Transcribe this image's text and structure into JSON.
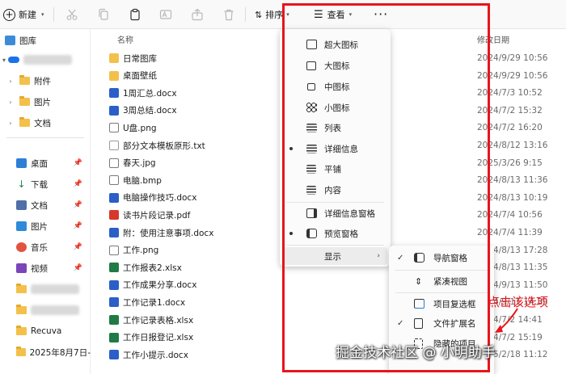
{
  "toolbar": {
    "new_label": "新建",
    "sort_label": "排序",
    "view_label": "查看",
    "more_label": "···"
  },
  "sidebar": {
    "gallery": "图库",
    "onedrive_folders": [
      "附件",
      "图片",
      "文档"
    ],
    "quick_access": [
      {
        "label": "桌面",
        "icon": "desktop-icon",
        "color": "#2d7fd6"
      },
      {
        "label": "下载",
        "icon": "download-icon",
        "color": "#1d8a4e"
      },
      {
        "label": "文档",
        "icon": "documents-icon",
        "color": "#4f6fa6"
      },
      {
        "label": "图片",
        "icon": "pictures-icon",
        "color": "#2f8bd8"
      },
      {
        "label": "音乐",
        "icon": "music-icon",
        "color": "#e1533e"
      },
      {
        "label": "视频",
        "icon": "video-icon",
        "color": "#7b45b8"
      }
    ],
    "recuva": "Recuva",
    "dated_folder": "2025年8月7日-"
  },
  "list": {
    "col_name": "名称",
    "col_date": "修改日期",
    "files": [
      {
        "name": "日常图库",
        "type": "folder",
        "date": "2024/9/29 10:56"
      },
      {
        "name": "桌面壁纸",
        "type": "folder",
        "date": "2024/9/29 10:56"
      },
      {
        "name": "1周汇总.docx",
        "type": "docx",
        "date": "2024/7/3 10:52"
      },
      {
        "name": "3周总结.docx",
        "type": "docx",
        "date": "2024/7/2 15:32"
      },
      {
        "name": "U盘.png",
        "type": "png",
        "date": "2024/7/2 16:20"
      },
      {
        "name": "部分文本模板原形.txt",
        "type": "txt",
        "date": "2024/8/12 13:16"
      },
      {
        "name": "春天.jpg",
        "type": "png",
        "date": "2025/3/26 9:15"
      },
      {
        "name": "电脑.bmp",
        "type": "png",
        "date": "2024/8/13 11:36"
      },
      {
        "name": "电脑操作技巧.docx",
        "type": "docx",
        "date": "2024/8/13 10:19"
      },
      {
        "name": "读书片段记录.pdf",
        "type": "pdf",
        "date": "2024/7/4 10:56"
      },
      {
        "name": "附：使用注意事项.docx",
        "type": "docx",
        "date": "2024/7/4 11:39"
      },
      {
        "name": "工作.png",
        "type": "png",
        "date": "2024/8/13 17:28"
      },
      {
        "name": "工作报表2.xlsx",
        "type": "xlsx",
        "date": "2024/8/13 11:35"
      },
      {
        "name": "工作成果分享.docx",
        "type": "docx",
        "date": "2024/9/13 11:50"
      },
      {
        "name": "工作记录1.docx",
        "type": "docx",
        "date": "2024/9/11 14:39"
      },
      {
        "name": "工作记录表格.xlsx",
        "type": "xlsx",
        "date": "2024/7/2 14:41"
      },
      {
        "name": "工作日报登记.xlsx",
        "type": "xlsx",
        "date": "2024/7/2 15:19"
      },
      {
        "name": "工作小提示.docx",
        "type": "docx",
        "date": "2025/2/18 11:12"
      }
    ]
  },
  "view_menu": {
    "items": [
      {
        "label": "超大图标",
        "icon": "extra-large-icons-icon",
        "selected": false
      },
      {
        "label": "大图标",
        "icon": "large-icons-icon",
        "selected": false
      },
      {
        "label": "中图标",
        "icon": "medium-icons-icon",
        "selected": false
      },
      {
        "label": "小图标",
        "icon": "small-icons-icon",
        "selected": false
      },
      {
        "label": "列表",
        "icon": "list-icon",
        "selected": false
      },
      {
        "label": "详细信息",
        "icon": "details-icon",
        "selected": true
      },
      {
        "label": "平铺",
        "icon": "tiles-icon",
        "selected": false
      },
      {
        "label": "内容",
        "icon": "content-icon",
        "selected": false
      }
    ],
    "details_pane": "详细信息窗格",
    "preview_pane": "预览窗格",
    "show": "显示"
  },
  "show_submenu": {
    "items": [
      {
        "label": "导航窗格",
        "checked": true,
        "icon": "navigation-pane-icon"
      },
      {
        "label": "紧凑视图",
        "checked": false,
        "icon": "compact-view-icon"
      },
      {
        "label": "项目复选框",
        "checked": false,
        "icon": "item-checkbox-icon"
      },
      {
        "label": "文件扩展名",
        "checked": true,
        "icon": "file-extension-icon"
      },
      {
        "label": "隐藏的项目",
        "checked": false,
        "icon": "hidden-items-icon"
      }
    ]
  },
  "annotation": {
    "text": "点击该选项",
    "color": "#e8141c"
  },
  "watermark": "掘金技术社区 @ 小明助手"
}
